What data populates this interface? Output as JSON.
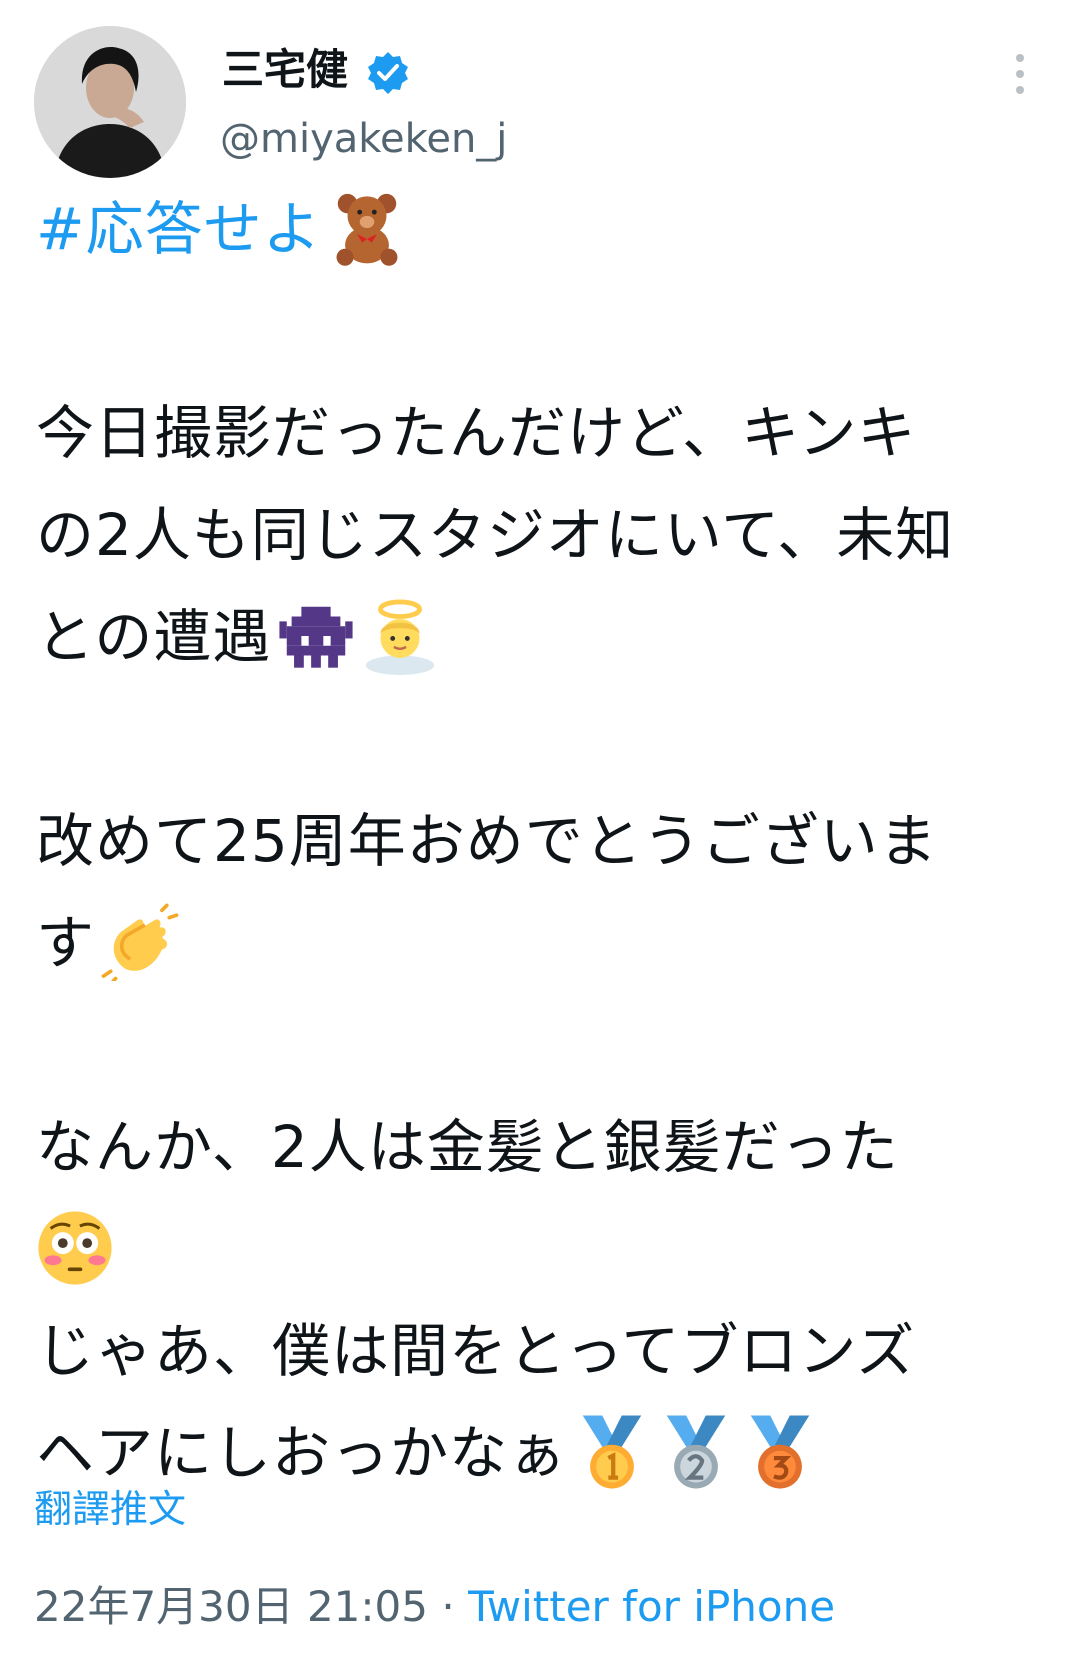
{
  "author": {
    "display_name": "三宅健",
    "handle": "@miyakeken_j",
    "verified": true,
    "avatar_icon": "profile-photo"
  },
  "tweet": {
    "hashtag": "#応答せよ",
    "lines": [
      "今日撮影だったんだけど、キンキ",
      "の2人も同じスタジオにいて、未知",
      "との遭遇",
      "改めて25周年おめでとうございま",
      "す",
      "なんか、2人は金髪と銀髪だった",
      "じゃあ、僕は間をとってブロンズ",
      "ヘアにしおっかなぁ"
    ],
    "emojis": {
      "hashtag": "teddy-bear-emoji",
      "encounter": [
        "alien-monster-emoji",
        "angel-emoji"
      ],
      "congrats": "clapping-hands-emoji",
      "hair": "flushed-face-emoji",
      "medals": [
        "gold-medal-emoji",
        "silver-medal-emoji",
        "bronze-medal-emoji"
      ]
    }
  },
  "actions": {
    "translate_label": "翻譯推文"
  },
  "meta": {
    "timestamp": "22年7月30日 21:05",
    "separator": " · ",
    "source": "Twitter for iPhone"
  },
  "colors": {
    "accent": "#1d9bf0",
    "text": "#0f1419",
    "secondary": "#536471"
  }
}
